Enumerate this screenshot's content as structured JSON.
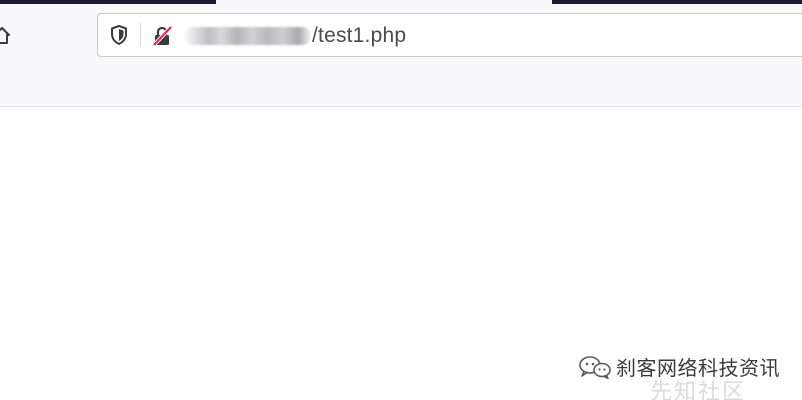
{
  "browser": {
    "url": {
      "host_redacted": true,
      "path": "/test1.php"
    },
    "icons": {
      "home": "home-icon",
      "tracking_protection": "shield-icon",
      "connection": "insecure-lock-icon"
    }
  },
  "watermark": {
    "label": "刹客网络科技资讯",
    "faint_label": "先知社区"
  },
  "colors": {
    "tab_strip": "#1c1b3a",
    "toolbar_bg": "#f9f9fb",
    "urlbar_border": "#c8c8cf",
    "url_text": "#4a4a4f",
    "insecure_slash": "#e22850"
  }
}
